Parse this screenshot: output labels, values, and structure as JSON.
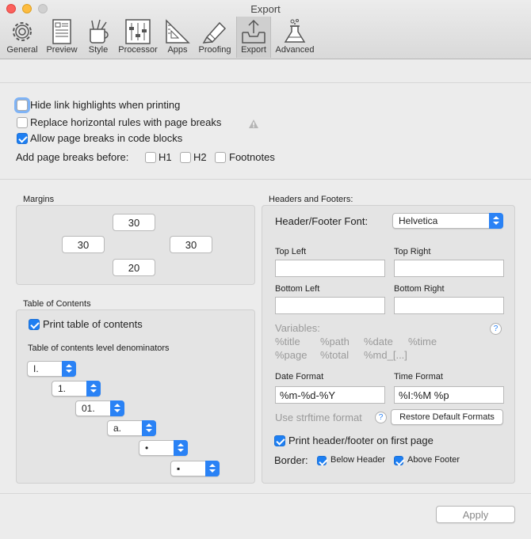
{
  "window": {
    "title": "Export"
  },
  "colors": {
    "accent": "#2a82f5",
    "close": "#fc615d",
    "minimize": "#fdbc40",
    "maximize": "#d0d0d0"
  },
  "toolbar": {
    "items": [
      {
        "label": "General",
        "icon": "gear-icon"
      },
      {
        "label": "Preview",
        "icon": "preview-icon"
      },
      {
        "label": "Style",
        "icon": "style-icon"
      },
      {
        "label": "Processor",
        "icon": "sliders-icon"
      },
      {
        "label": "Apps",
        "icon": "apps-icon"
      },
      {
        "label": "Proofing",
        "icon": "highlighter-icon"
      },
      {
        "label": "Export",
        "icon": "export-tray-icon",
        "selected": true
      },
      {
        "label": "Advanced",
        "icon": "flask-icon"
      }
    ]
  },
  "options": {
    "hide_link_highlights": {
      "label": "Hide link highlights when printing",
      "checked": false
    },
    "replace_hr": {
      "label": "Replace horizontal rules with page breaks",
      "checked": false,
      "icon": "warning-icon"
    },
    "allow_breaks_code": {
      "label": "Allow page breaks in code blocks",
      "checked": true
    },
    "add_breaks": {
      "label": "Add page breaks before:",
      "h1": {
        "label": "H1",
        "checked": false
      },
      "h2": {
        "label": "H2",
        "checked": false
      },
      "footnotes": {
        "label": "Footnotes",
        "checked": false
      }
    }
  },
  "margins": {
    "title": "Margins",
    "top": "30",
    "left": "30",
    "right": "30",
    "bottom": "20"
  },
  "toc": {
    "title": "Table of Contents",
    "print": {
      "label": "Print table of contents",
      "checked": true
    },
    "denominators_label": "Table of contents level denominators",
    "levels": [
      "I.",
      "1.",
      "01.",
      "a.",
      "•",
      "▪"
    ]
  },
  "headers_footers": {
    "title": "Headers and Footers:",
    "font_label": "Header/Footer Font:",
    "font_value": "Helvetica",
    "top_left_label": "Top Left",
    "top_right_label": "Top Right",
    "bottom_left_label": "Bottom Left",
    "bottom_right_label": "Bottom Right",
    "top_left": "",
    "top_right": "",
    "bottom_left": "",
    "bottom_right": "",
    "variables_label": "Variables:",
    "variables": [
      "%title",
      "%path",
      "%date",
      "%time",
      "%page",
      "%total",
      "%md_[...]"
    ],
    "date_format_label": "Date Format",
    "date_format": "%m-%d-%Y",
    "time_format_label": "Time Format",
    "time_format": "%I:%M %p",
    "strftime_label": "Use strftime format",
    "restore_label": "Restore Default Formats",
    "print_first_page": {
      "label": "Print header/footer on first page",
      "checked": true
    },
    "border_label": "Border:",
    "below_header": {
      "label": "Below Header",
      "checked": true
    },
    "above_footer": {
      "label": "Above Footer",
      "checked": true
    }
  },
  "apply_label": "Apply"
}
